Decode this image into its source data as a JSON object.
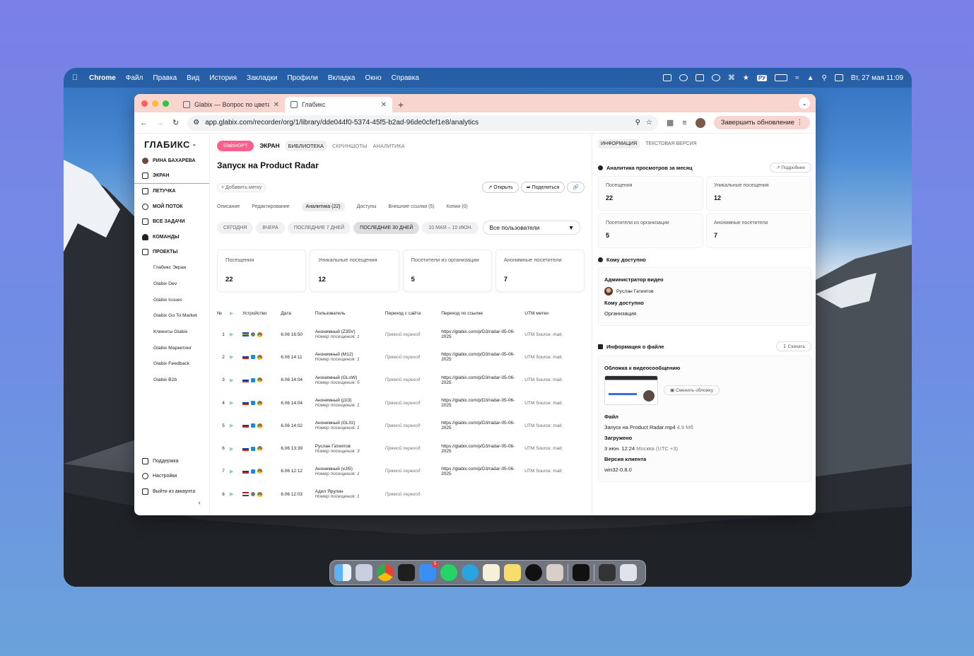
{
  "menubar": {
    "app": "Chrome",
    "items": [
      "Файл",
      "Правка",
      "Вид",
      "История",
      "Закладки",
      "Профили",
      "Вкладка",
      "Окно",
      "Справка"
    ],
    "input_source": "РУ",
    "clock": "Вт, 27 мая  11:09"
  },
  "browser": {
    "tabs": [
      {
        "title": "Glabix — Вопрос по цветам"
      },
      {
        "title": "Глабикс"
      }
    ],
    "url": "app.glabix.com/recorder/org/1/library/dde044f0-5374-45f5-b2ad-96de0cfef1e8/analytics",
    "update_button": "Завершить обновление"
  },
  "sidebar": {
    "logo": "ГЛАБИКС",
    "user": "РИНА БАХАРЕВА",
    "items": [
      {
        "label": "ЭКРАН",
        "icon": "screen-icon"
      },
      {
        "label": "ЛЕТУЧКА",
        "icon": "meeting-icon"
      },
      {
        "label": "МОЙ ПОТОК",
        "icon": "chat-icon"
      },
      {
        "label": "ВСЕ ЗАДАЧИ",
        "icon": "tasks-icon"
      },
      {
        "label": "КОМАНДЫ",
        "icon": "team-icon"
      },
      {
        "label": "ПРОЕКТЫ",
        "icon": "folder-icon"
      }
    ],
    "projects": [
      "Глабикс Экран",
      "Glabix Dev",
      "Glabix Issues",
      "Glabix Go To Market",
      "Клиенты Glabix",
      "Glabix Маркетинг",
      "Glabix Feedback",
      "Glabix B2b"
    ],
    "bottom": [
      {
        "label": "Поддержка",
        "icon": "support-icon"
      },
      {
        "label": "Настройки",
        "icon": "settings-icon"
      },
      {
        "label": "Выйти из аккаунта",
        "icon": "logout-icon"
      }
    ]
  },
  "main": {
    "nav": {
      "gpt": "GlabixGPT",
      "screen": "ЭКРАН",
      "library": "БИБЛИОТЕКА",
      "screenshots": "СКРИНШОТЫ",
      "analytics": "АНАЛИТИКА"
    },
    "title": "Запуск на Product Radar",
    "add_tag": "+ Добавить метку",
    "open": "Открыть",
    "share": "Поделиться",
    "subtabs": [
      "Описание",
      "Редактирование",
      "Аналитика (22)",
      "Доступы",
      "Внешние ссылки (5)",
      "Копии (0)"
    ],
    "periods": [
      "СЕГОДНЯ",
      "ВЧЕРА",
      "ПОСЛЕДНИЕ 7 ДНЕЙ",
      "ПОСЛЕДНИЕ 30 ДНЕЙ",
      "10 МАЯ – 10 ИЮН."
    ],
    "user_filter": "Все пользователи",
    "stats": [
      {
        "label": "Посещения",
        "value": "22"
      },
      {
        "label": "Уникальные посещения",
        "value": "12"
      },
      {
        "label": "Посетители из организации",
        "value": "5"
      },
      {
        "label": "Анонимные посетители",
        "value": "7"
      }
    ],
    "table": {
      "headers": [
        "№",
        "",
        "Устройство",
        "Дата",
        "Пользователь",
        "Переход с сайта",
        "Переход по ссылке",
        "UTM метки"
      ],
      "rows": [
        {
          "n": "1",
          "flag": "se",
          "os": "mac",
          "date": "6.06 16:50",
          "user": "Анонимный (Z35V)",
          "visit": "Номер посещения: 1",
          "ref": "Прямой переход",
          "link": "https://glabix.com/p/D3/radar-05-06-2025",
          "utm": "UTM Source: mail;"
        },
        {
          "n": "2",
          "flag": "ru",
          "os": "win",
          "date": "6.06 14:11",
          "user": "Анонимный (M12)",
          "visit": "Номер посещения: 1",
          "ref": "Прямой переход",
          "link": "https://glabix.com/p/D3/radar-05-06-2025",
          "utm": "UTM Source: mail;"
        },
        {
          "n": "3",
          "flag": "ru",
          "os": "win",
          "date": "6.06 14:04",
          "user": "Анонимный (GLoW)",
          "visit": "Номер посещения: 5",
          "ref": "Прямой переход",
          "link": "https://glabix.com/p/D3/radar-05-06-2025",
          "utm": "UTM Source: mail;"
        },
        {
          "n": "4",
          "flag": "ru",
          "os": "win",
          "date": "6.06 14:04",
          "user": "Анонимный (j1I3)",
          "visit": "Номер посещения: 1",
          "ref": "Прямой переход",
          "link": "https://glabix.com/p/D3/radar-05-06-2025",
          "utm": "UTM Source: mail;"
        },
        {
          "n": "5",
          "flag": "ru",
          "os": "win",
          "date": "6.06 14:02",
          "user": "Анонимный (GL0z)",
          "visit": "Номер посещения: 1",
          "ref": "Прямой переход",
          "link": "https://glabix.com/p/D3/radar-05-06-2025",
          "utm": "UTM Source: mail;"
        },
        {
          "n": "6",
          "flag": "ru",
          "os": "win",
          "date": "6.06 13:39",
          "user": "Руслан Гатиятов",
          "visit": "Номер посещения: 3",
          "ref": "Прямой переход",
          "link": "https://glabix.com/p/D3/radar-05-06-2025",
          "utm": "UTM Source: mail;"
        },
        {
          "n": "7",
          "flag": "ru",
          "os": "win",
          "date": "6.06 12:12",
          "user": "Анонимный (vJI5)",
          "visit": "Номер посещения: 1",
          "ref": "Прямой переход",
          "link": "https://glabix.com/p/D3/radar-05-06-2025",
          "utm": "UTM Source: mail;"
        },
        {
          "n": "8",
          "flag": "nl",
          "os": "mac",
          "date": "6.06 12:03",
          "user": "Адил Ярулин",
          "visit": "Номер посещения: 1",
          "ref": "Прямой переход",
          "link": "",
          "utm": ""
        }
      ]
    }
  },
  "panel": {
    "tabs": [
      "ИНФОРМАЦИЯ",
      "ТЕКСТОВАЯ ВЕРСИЯ"
    ],
    "analytics_title": "Аналитика просмотров за месяц",
    "details": "Подробнее",
    "stats": [
      {
        "label": "Посещения",
        "value": "22"
      },
      {
        "label": "Уникальные посещения",
        "value": "12"
      },
      {
        "label": "Посетители из организации",
        "value": "5"
      },
      {
        "label": "Анонимные посетители",
        "value": "7"
      }
    ],
    "access_title": "Кому доступно",
    "admin_label": "Администратор видео",
    "admin_name": "Руслан Гатиятов",
    "access_label": "Кому доступно",
    "access_value": "Организация",
    "file_title": "Информация о файле",
    "download": "Скачать",
    "cover_label": "Обложка к видеосообщению",
    "change_cover": "Сменить обложку",
    "file_label": "Файл",
    "file_name": "Запуск на Product Radar.mp4",
    "file_size": "4.9 Мб",
    "uploaded_label": "Загружено",
    "uploaded_value": "3 июн. 12:24",
    "uploaded_tz": "Москва (UTC +3)",
    "client_label": "Версия клиента",
    "client_value": "win32-0.8.0"
  },
  "dock_notification": "5"
}
